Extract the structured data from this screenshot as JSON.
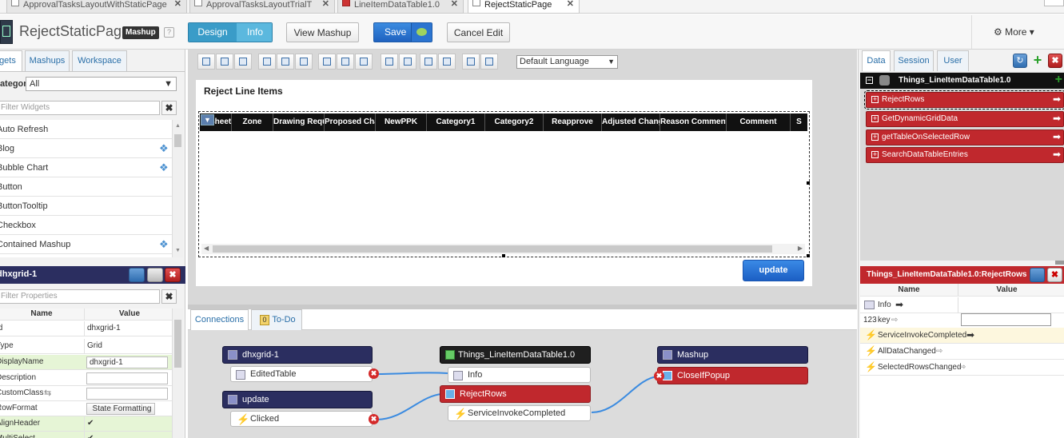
{
  "tabs": [
    {
      "label": "ApprovalTasksLayoutWithStaticPage"
    },
    {
      "label": "ApprovalTasksLayoutTrialT"
    },
    {
      "label": "LineItemDataTable1.0"
    },
    {
      "label": "RejectStaticPage"
    }
  ],
  "header": {
    "title": "RejectStaticPage",
    "badge": "Mashup",
    "help": "?",
    "design_label": "Design",
    "info_label": "Info",
    "view_mashup_label": "View Mashup",
    "save_label": "Save",
    "cancel_label": "Cancel Edit",
    "more_label": "More"
  },
  "left_panel": {
    "tabs": [
      "Widgets",
      "Mashups",
      "Workspace"
    ],
    "category_label": "Category",
    "category_value": "All",
    "filter_placeholder": "Filter Widgets",
    "widgets": [
      "Auto Refresh",
      "Blog",
      "Bubble Chart",
      "Button",
      "ButtonTooltip",
      "Checkbox",
      "Contained Mashup"
    ]
  },
  "props_panel": {
    "title": "dhxgrid-1",
    "filter_placeholder": "Filter Properties",
    "col_name": "Name",
    "col_value": "Value",
    "rows": [
      {
        "name": "Id",
        "value": "dhxgrid-1"
      },
      {
        "name": "Type",
        "value": "Grid"
      },
      {
        "name": "DisplayName",
        "value": "dhxgrid-1"
      },
      {
        "name": "Description",
        "value": ""
      },
      {
        "name": "CustomClass",
        "value": ""
      },
      {
        "name": "RowFormat",
        "value": "State Formatting"
      },
      {
        "name": "AlignHeader",
        "value": "✔"
      },
      {
        "name": "MultiSelect",
        "value": "✔"
      }
    ]
  },
  "canvas": {
    "language": "Default Language",
    "panel_title": "Reject Line Items",
    "grid_columns": [
      "Sheet",
      "Zone",
      "Drawing Requirements",
      "Proposed Change",
      "NewPPK",
      "Category1",
      "Category2",
      "Reapprove",
      "Adjusted Change",
      "Reason Comment",
      "Comment",
      "S"
    ],
    "update_label": "update"
  },
  "bottom": {
    "tabs": [
      "Connections",
      "To-Do"
    ],
    "todo_count": "0",
    "nodes": {
      "grid_title": "dhxgrid-1",
      "grid_event": "EditedTable",
      "update_title": "update",
      "update_event": "Clicked",
      "thing_title": "Things_LineItemDataTable1.0",
      "thing_info": "Info",
      "reject_service": "RejectRows",
      "service_complete": "ServiceInvokeCompleted",
      "mashup_title": "Mashup",
      "close_popup": "CloseIfPopup"
    }
  },
  "right_panel": {
    "tabs": [
      "Data",
      "Session",
      "User"
    ],
    "entity": "Things_LineItemDataTable1.0",
    "services": [
      "RejectRows",
      "GetDynamicGridData",
      "getTableOnSelectedRow",
      "SearchDataTableEntries"
    ],
    "detail_title": "Things_LineItemDataTable1.0:RejectRows",
    "col_name": "Name",
    "col_value": "Value",
    "params": [
      {
        "name": "Info"
      },
      {
        "name": "key",
        "prefix": "123"
      }
    ],
    "events": [
      "ServiceInvokeCompleted",
      "AllDataChanged",
      "SelectedRowsChanged"
    ]
  },
  "colors": {
    "primary_blue": "#2f7fd0",
    "service_red": "#c0282d",
    "node_dark": "#2b2e60",
    "canvas_bg": "#dadada"
  }
}
